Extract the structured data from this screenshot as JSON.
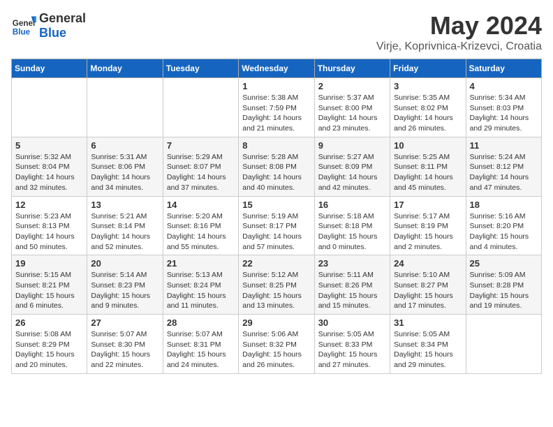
{
  "header": {
    "logo_general": "General",
    "logo_blue": "Blue",
    "month": "May 2024",
    "location": "Virje, Koprivnica-Krizevci, Croatia"
  },
  "weekdays": [
    "Sunday",
    "Monday",
    "Tuesday",
    "Wednesday",
    "Thursday",
    "Friday",
    "Saturday"
  ],
  "weeks": [
    [
      {
        "day": "",
        "info": ""
      },
      {
        "day": "",
        "info": ""
      },
      {
        "day": "",
        "info": ""
      },
      {
        "day": "1",
        "info": "Sunrise: 5:38 AM\nSunset: 7:59 PM\nDaylight: 14 hours\nand 21 minutes."
      },
      {
        "day": "2",
        "info": "Sunrise: 5:37 AM\nSunset: 8:00 PM\nDaylight: 14 hours\nand 23 minutes."
      },
      {
        "day": "3",
        "info": "Sunrise: 5:35 AM\nSunset: 8:02 PM\nDaylight: 14 hours\nand 26 minutes."
      },
      {
        "day": "4",
        "info": "Sunrise: 5:34 AM\nSunset: 8:03 PM\nDaylight: 14 hours\nand 29 minutes."
      }
    ],
    [
      {
        "day": "5",
        "info": "Sunrise: 5:32 AM\nSunset: 8:04 PM\nDaylight: 14 hours\nand 32 minutes."
      },
      {
        "day": "6",
        "info": "Sunrise: 5:31 AM\nSunset: 8:06 PM\nDaylight: 14 hours\nand 34 minutes."
      },
      {
        "day": "7",
        "info": "Sunrise: 5:29 AM\nSunset: 8:07 PM\nDaylight: 14 hours\nand 37 minutes."
      },
      {
        "day": "8",
        "info": "Sunrise: 5:28 AM\nSunset: 8:08 PM\nDaylight: 14 hours\nand 40 minutes."
      },
      {
        "day": "9",
        "info": "Sunrise: 5:27 AM\nSunset: 8:09 PM\nDaylight: 14 hours\nand 42 minutes."
      },
      {
        "day": "10",
        "info": "Sunrise: 5:25 AM\nSunset: 8:11 PM\nDaylight: 14 hours\nand 45 minutes."
      },
      {
        "day": "11",
        "info": "Sunrise: 5:24 AM\nSunset: 8:12 PM\nDaylight: 14 hours\nand 47 minutes."
      }
    ],
    [
      {
        "day": "12",
        "info": "Sunrise: 5:23 AM\nSunset: 8:13 PM\nDaylight: 14 hours\nand 50 minutes."
      },
      {
        "day": "13",
        "info": "Sunrise: 5:21 AM\nSunset: 8:14 PM\nDaylight: 14 hours\nand 52 minutes."
      },
      {
        "day": "14",
        "info": "Sunrise: 5:20 AM\nSunset: 8:16 PM\nDaylight: 14 hours\nand 55 minutes."
      },
      {
        "day": "15",
        "info": "Sunrise: 5:19 AM\nSunset: 8:17 PM\nDaylight: 14 hours\nand 57 minutes."
      },
      {
        "day": "16",
        "info": "Sunrise: 5:18 AM\nSunset: 8:18 PM\nDaylight: 15 hours\nand 0 minutes."
      },
      {
        "day": "17",
        "info": "Sunrise: 5:17 AM\nSunset: 8:19 PM\nDaylight: 15 hours\nand 2 minutes."
      },
      {
        "day": "18",
        "info": "Sunrise: 5:16 AM\nSunset: 8:20 PM\nDaylight: 15 hours\nand 4 minutes."
      }
    ],
    [
      {
        "day": "19",
        "info": "Sunrise: 5:15 AM\nSunset: 8:21 PM\nDaylight: 15 hours\nand 6 minutes."
      },
      {
        "day": "20",
        "info": "Sunrise: 5:14 AM\nSunset: 8:23 PM\nDaylight: 15 hours\nand 9 minutes."
      },
      {
        "day": "21",
        "info": "Sunrise: 5:13 AM\nSunset: 8:24 PM\nDaylight: 15 hours\nand 11 minutes."
      },
      {
        "day": "22",
        "info": "Sunrise: 5:12 AM\nSunset: 8:25 PM\nDaylight: 15 hours\nand 13 minutes."
      },
      {
        "day": "23",
        "info": "Sunrise: 5:11 AM\nSunset: 8:26 PM\nDaylight: 15 hours\nand 15 minutes."
      },
      {
        "day": "24",
        "info": "Sunrise: 5:10 AM\nSunset: 8:27 PM\nDaylight: 15 hours\nand 17 minutes."
      },
      {
        "day": "25",
        "info": "Sunrise: 5:09 AM\nSunset: 8:28 PM\nDaylight: 15 hours\nand 19 minutes."
      }
    ],
    [
      {
        "day": "26",
        "info": "Sunrise: 5:08 AM\nSunset: 8:29 PM\nDaylight: 15 hours\nand 20 minutes."
      },
      {
        "day": "27",
        "info": "Sunrise: 5:07 AM\nSunset: 8:30 PM\nDaylight: 15 hours\nand 22 minutes."
      },
      {
        "day": "28",
        "info": "Sunrise: 5:07 AM\nSunset: 8:31 PM\nDaylight: 15 hours\nand 24 minutes."
      },
      {
        "day": "29",
        "info": "Sunrise: 5:06 AM\nSunset: 8:32 PM\nDaylight: 15 hours\nand 26 minutes."
      },
      {
        "day": "30",
        "info": "Sunrise: 5:05 AM\nSunset: 8:33 PM\nDaylight: 15 hours\nand 27 minutes."
      },
      {
        "day": "31",
        "info": "Sunrise: 5:05 AM\nSunset: 8:34 PM\nDaylight: 15 hours\nand 29 minutes."
      },
      {
        "day": "",
        "info": ""
      }
    ]
  ]
}
